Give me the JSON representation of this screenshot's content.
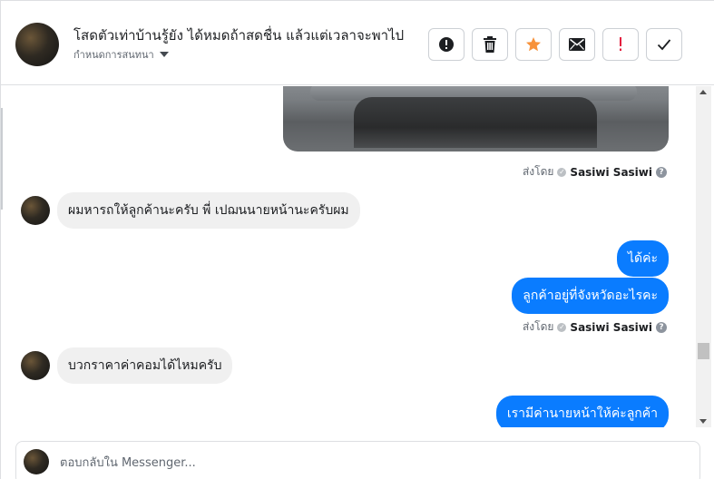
{
  "header": {
    "title": "โสดตัวเท่าบ้านรู้ยัง ได้หมดถ้าสดชื่น แล้วแต่เวลาจะพาไป",
    "assign_label": "กำหนดการสนทนา",
    "avatar_icon": "user-avatar-icon",
    "actions": [
      {
        "name": "mark-spam",
        "icon": "exclamation-circle-icon",
        "color": "#1c1e21"
      },
      {
        "name": "delete",
        "icon": "trash-icon",
        "color": "#1c1e21"
      },
      {
        "name": "star",
        "icon": "star-icon",
        "color": "#f7923b"
      },
      {
        "name": "mark-unread",
        "icon": "envelope-icon",
        "color": "#1c1e21"
      },
      {
        "name": "follow-up",
        "icon": "exclamation-icon",
        "color": "#e41e3f"
      },
      {
        "name": "done",
        "icon": "checkmark-icon",
        "color": "#1c1e21"
      }
    ]
  },
  "messages": {
    "sent_by_label": "ส่งโดย",
    "sender_name": "Sasiwi Sasiwi",
    "items": [
      {
        "type": "image",
        "direction": "out"
      },
      {
        "type": "text",
        "direction": "in",
        "text": "ผมหารถให้ลูกค้านะครับ พี่ เปฌนนายหน้านะครับผม"
      },
      {
        "type": "text",
        "direction": "out",
        "text": "ได้ค่ะ"
      },
      {
        "type": "text",
        "direction": "out",
        "text": "ลูกค้าอยู่ที่จังหวัดอะไรคะ"
      },
      {
        "type": "text",
        "direction": "in",
        "text": "บวกราคาค่าคอมได้ไหมครับ"
      },
      {
        "type": "text",
        "direction": "out",
        "text": "เรามีค่านายหน้าให้ค่ะลูกค้า"
      }
    ]
  },
  "composer": {
    "placeholder": "ตอบกลับใน Messenger..."
  },
  "colors": {
    "outgoing_bubble": "#0a7cff",
    "incoming_bubble": "#f0f0f0",
    "star_accent": "#f7923b",
    "flag_accent": "#e41e3f"
  }
}
